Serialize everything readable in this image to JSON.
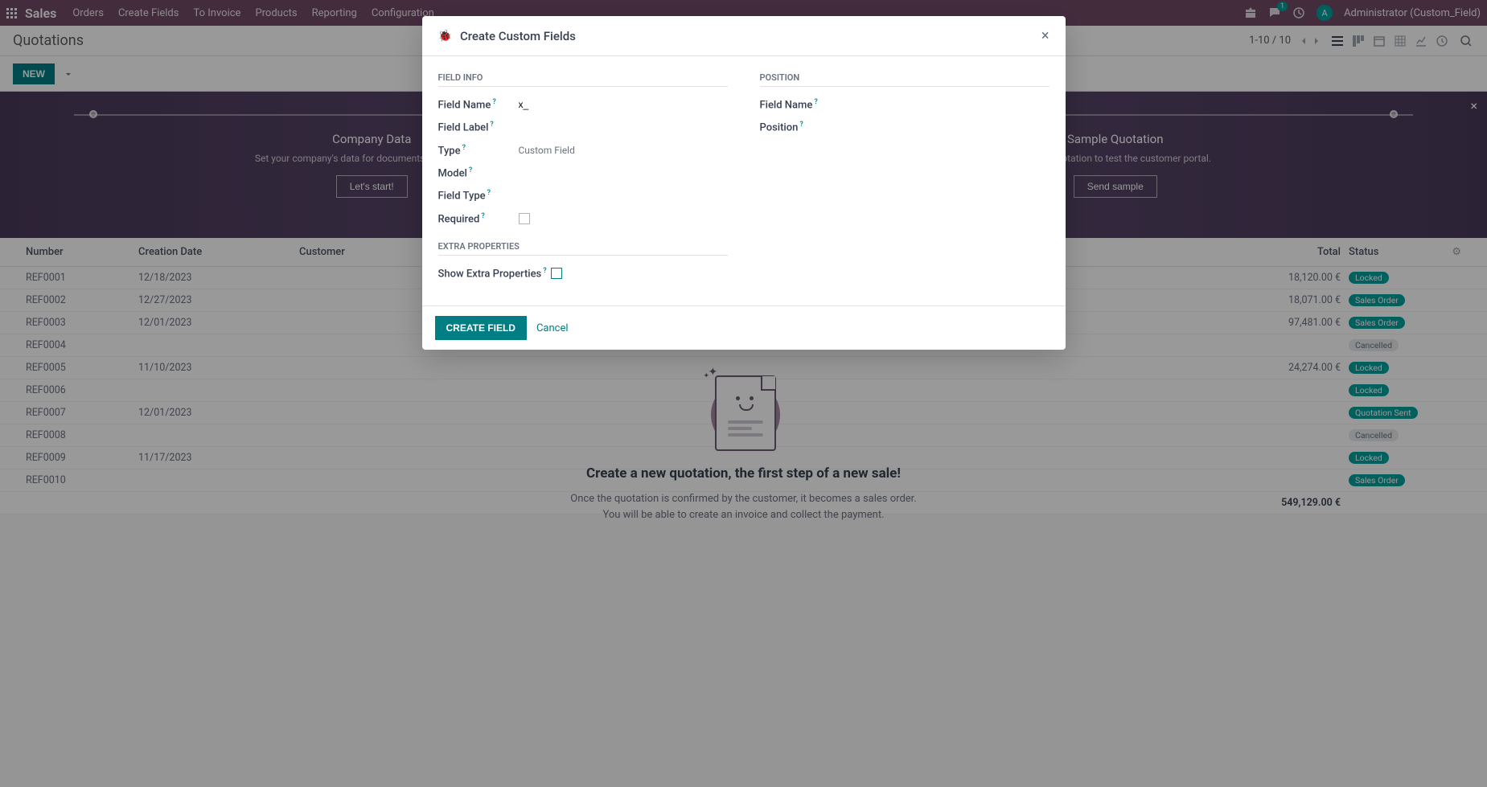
{
  "topnav": {
    "brand": "Sales",
    "menu": [
      "Orders",
      "Create Fields",
      "To Invoice",
      "Products",
      "Reporting",
      "Configuration"
    ],
    "chat_count": "1",
    "user_initial": "A",
    "user_label": "Administrator (Custom_Field)"
  },
  "controlbar": {
    "title": "Quotations",
    "pager": "1-10 / 10"
  },
  "actionbar": {
    "new_label": "NEW"
  },
  "banner": {
    "left": {
      "title": "Company Data",
      "desc": "Set your company's data for documents header/footer.",
      "btn": "Let's start!"
    },
    "right": {
      "title": "Sample Quotation",
      "desc": "Send a quotation to test the customer portal.",
      "btn": "Send sample"
    }
  },
  "table": {
    "headers": {
      "number": "Number",
      "date": "Creation Date",
      "customer": "Customer",
      "total": "Total",
      "status": "Status"
    },
    "rows": [
      {
        "num": "REF0001",
        "date": "12/18/2023",
        "cust": "",
        "total": "18,120.00 €",
        "status": "Locked",
        "teal": true
      },
      {
        "num": "REF0002",
        "date": "12/27/2023",
        "cust": "",
        "total": "18,071.00 €",
        "status": "Sales Order",
        "teal": true
      },
      {
        "num": "REF0003",
        "date": "12/01/2023",
        "cust": "",
        "total": "97,481.00 €",
        "status": "Sales Order",
        "teal": true
      },
      {
        "num": "REF0004",
        "date": "",
        "cust": "",
        "total": "",
        "status": "Cancelled",
        "teal": false
      },
      {
        "num": "REF0005",
        "date": "11/10/2023",
        "cust": "",
        "total": "24,274.00 €",
        "status": "Locked",
        "teal": true
      },
      {
        "num": "REF0006",
        "date": "",
        "cust": "",
        "total": "",
        "status": "Locked",
        "teal": true
      },
      {
        "num": "REF0007",
        "date": "12/01/2023",
        "cust": "",
        "total": "",
        "status": "Quotation Sent",
        "teal": true
      },
      {
        "num": "REF0008",
        "date": "",
        "cust": "",
        "total": "",
        "status": "Cancelled",
        "teal": false
      },
      {
        "num": "REF0009",
        "date": "11/17/2023",
        "cust": "",
        "total": "",
        "status": "Locked",
        "teal": true
      },
      {
        "num": "REF0010",
        "date": "",
        "cust": "",
        "total": "",
        "status": "Sales Order",
        "teal": true
      }
    ],
    "total": "549,129.00 €"
  },
  "emptystate": {
    "title": "Create a new quotation, the first step of a new sale!",
    "line1": "Once the quotation is confirmed by the customer, it becomes a sales order.",
    "line2": "You will be able to create an invoice and collect the payment."
  },
  "modal": {
    "title": "Create Custom Fields",
    "section_field_info": "FIELD INFO",
    "section_position": "POSITION",
    "section_extra": "EXTRA PROPERTIES",
    "fields": {
      "field_name": "Field Name",
      "field_name_val": "x_",
      "field_label": "Field Label",
      "type": "Type",
      "type_val": "Custom Field",
      "model": "Model",
      "field_type": "Field Type",
      "required": "Required",
      "pos_field_name": "Field Name",
      "position": "Position",
      "show_extra": "Show Extra Properties"
    },
    "create_btn": "CREATE FIELD",
    "cancel": "Cancel"
  }
}
